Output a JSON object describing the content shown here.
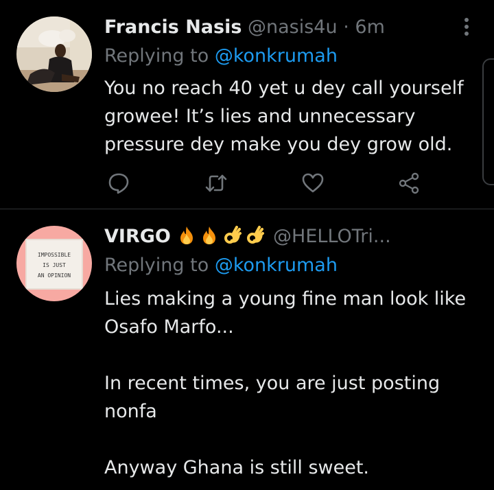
{
  "tweets": [
    {
      "name": "Francis Nasis",
      "handle": "@nasis4u",
      "separator": "·",
      "time": "6m",
      "replying_label": "Replying to",
      "replying_to": "@konkrumah",
      "text": "You no reach 40 yet u dey call yourself growee! It’s lies and unnecessary pressure dey make you dey grow old."
    },
    {
      "name": "VIRGO",
      "name_emojis": [
        "fire",
        "fire",
        "ok-hand",
        "ok-hand"
      ],
      "handle": "@HELLOTri...",
      "replying_label": "Replying to",
      "replying_to": "@konkrumah",
      "text": "Lies making a young fine man look like Osafo Marfo...\n\nIn recent times, you are just posting nonfa\n\nAnyway Ghana is still sweet.",
      "avatar_sign": [
        "IMPOSSIBLE",
        "IS JUST",
        "AN OPINION"
      ]
    }
  ],
  "icons": {
    "more": "more-vertical-icon",
    "reply": "reply-icon",
    "retweet": "retweet-icon",
    "like": "heart-icon",
    "share": "share-icon"
  },
  "colors": {
    "background": "#000000",
    "text": "#e7e9ea",
    "secondary": "#71767b",
    "link": "#1d9bf0",
    "divider": "#2f3336"
  }
}
